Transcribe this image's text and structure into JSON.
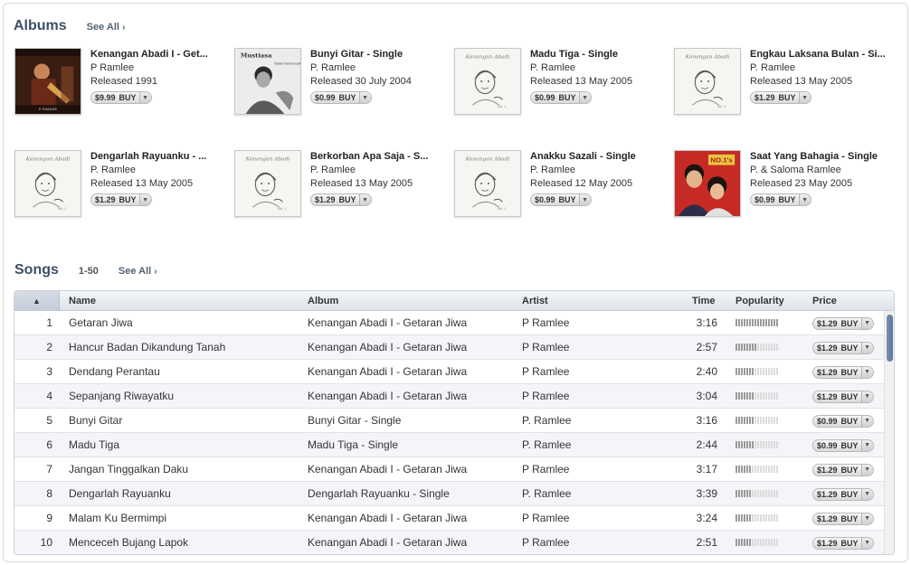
{
  "albums_section": {
    "title": "Albums",
    "see_all": "See All",
    "items": [
      {
        "title": "Kenangan Abadi I - Get...",
        "artist": "P Ramlee",
        "released": "Released 1991",
        "price": "$9.99",
        "buy": "BUY",
        "art": "concert"
      },
      {
        "title": "Bunyi Gitar - Single",
        "artist": "P. Ramlee",
        "released": "Released 30 July 2004",
        "price": "$0.99",
        "buy": "BUY",
        "art": "old-photo"
      },
      {
        "title": "Madu Tiga - Single",
        "artist": "P. Ramlee",
        "released": "Released 13 May 2005",
        "price": "$0.99",
        "buy": "BUY",
        "art": "portrait-bw"
      },
      {
        "title": "Engkau Laksana Bulan - Si...",
        "artist": "P. Ramlee",
        "released": "Released 13 May 2005",
        "price": "$1.29",
        "buy": "BUY",
        "art": "portrait-bw"
      },
      {
        "title": "Dengarlah Rayuanku - ...",
        "artist": "P. Ramlee",
        "released": "Released 13 May 2005",
        "price": "$1.29",
        "buy": "BUY",
        "art": "portrait-bw"
      },
      {
        "title": "Berkorban Apa Saja - S...",
        "artist": "P. Ramlee",
        "released": "Released 13 May 2005",
        "price": "$1.29",
        "buy": "BUY",
        "art": "portrait-bw"
      },
      {
        "title": "Anakku Sazali - Single",
        "artist": "P. Ramlee",
        "released": "Released 12 May 2005",
        "price": "$0.99",
        "buy": "BUY",
        "art": "portrait-bw"
      },
      {
        "title": "Saat Yang Bahagia - Single",
        "artist": "P. & Saloma Ramlee",
        "released": "Released 23 May 2005",
        "price": "$0.99",
        "buy": "BUY",
        "art": "color-red"
      }
    ]
  },
  "songs_section": {
    "title": "Songs",
    "range": "1-50",
    "see_all": "See All",
    "columns": {
      "sort": "▲",
      "name": "Name",
      "album": "Album",
      "artist": "Artist",
      "time": "Time",
      "popularity": "Popularity",
      "price": "Price"
    },
    "rows": [
      {
        "num": "1",
        "name": "Getaran Jiwa",
        "album": "Kenangan Abadi I - Getaran Jiwa",
        "artist": "P Ramlee",
        "time": "3:16",
        "popularity": 1.0,
        "price": "$1.29",
        "buy": "BUY"
      },
      {
        "num": "2",
        "name": "Hancur Badan Dikandung Tanah",
        "album": "Kenangan Abadi I - Getaran Jiwa",
        "artist": "P Ramlee",
        "time": "2:57",
        "popularity": 0.5,
        "price": "$1.29",
        "buy": "BUY"
      },
      {
        "num": "3",
        "name": "Dendang Perantau",
        "album": "Kenangan Abadi I - Getaran Jiwa",
        "artist": "P Ramlee",
        "time": "2:40",
        "popularity": 0.45,
        "price": "$1.29",
        "buy": "BUY"
      },
      {
        "num": "4",
        "name": "Sepanjang Riwayatku",
        "album": "Kenangan Abadi I - Getaran Jiwa",
        "artist": "P Ramlee",
        "time": "3:04",
        "popularity": 0.45,
        "price": "$1.29",
        "buy": "BUY"
      },
      {
        "num": "5",
        "name": "Bunyi Gitar",
        "album": "Bunyi Gitar - Single",
        "artist": "P. Ramlee",
        "time": "3:16",
        "popularity": 0.45,
        "price": "$0.99",
        "buy": "BUY"
      },
      {
        "num": "6",
        "name": "Madu Tiga",
        "album": "Madu Tiga - Single",
        "artist": "P. Ramlee",
        "time": "2:44",
        "popularity": 0.45,
        "price": "$0.99",
        "buy": "BUY"
      },
      {
        "num": "7",
        "name": "Jangan Tinggalkan Daku",
        "album": "Kenangan Abadi I - Getaran Jiwa",
        "artist": "P Ramlee",
        "time": "3:17",
        "popularity": 0.4,
        "price": "$1.29",
        "buy": "BUY"
      },
      {
        "num": "8",
        "name": "Dengarlah Rayuanku",
        "album": "Dengarlah Rayuanku - Single",
        "artist": "P. Ramlee",
        "time": "3:39",
        "popularity": 0.4,
        "price": "$1.29",
        "buy": "BUY"
      },
      {
        "num": "9",
        "name": "Malam Ku Bermimpi",
        "album": "Kenangan Abadi I - Getaran Jiwa",
        "artist": "P Ramlee",
        "time": "3:24",
        "popularity": 0.35,
        "price": "$1.29",
        "buy": "BUY"
      },
      {
        "num": "10",
        "name": "Menceceh Bujang Lapok",
        "album": "Kenangan Abadi I - Getaran Jiwa",
        "artist": "P Ramlee",
        "time": "2:51",
        "popularity": 0.35,
        "price": "$1.29",
        "buy": "BUY"
      }
    ]
  },
  "icons": {
    "see_all_chevron": "chevron-right-icon",
    "buy_dropdown": "dropdown-arrow-icon",
    "sort": "sort-ascending-icon"
  },
  "colors": {
    "section_title": "#3d4f66",
    "scroll_thumb": "#5d7799",
    "popularity_on": "#9a9a9a",
    "popularity_off": "#dcdcdc"
  }
}
